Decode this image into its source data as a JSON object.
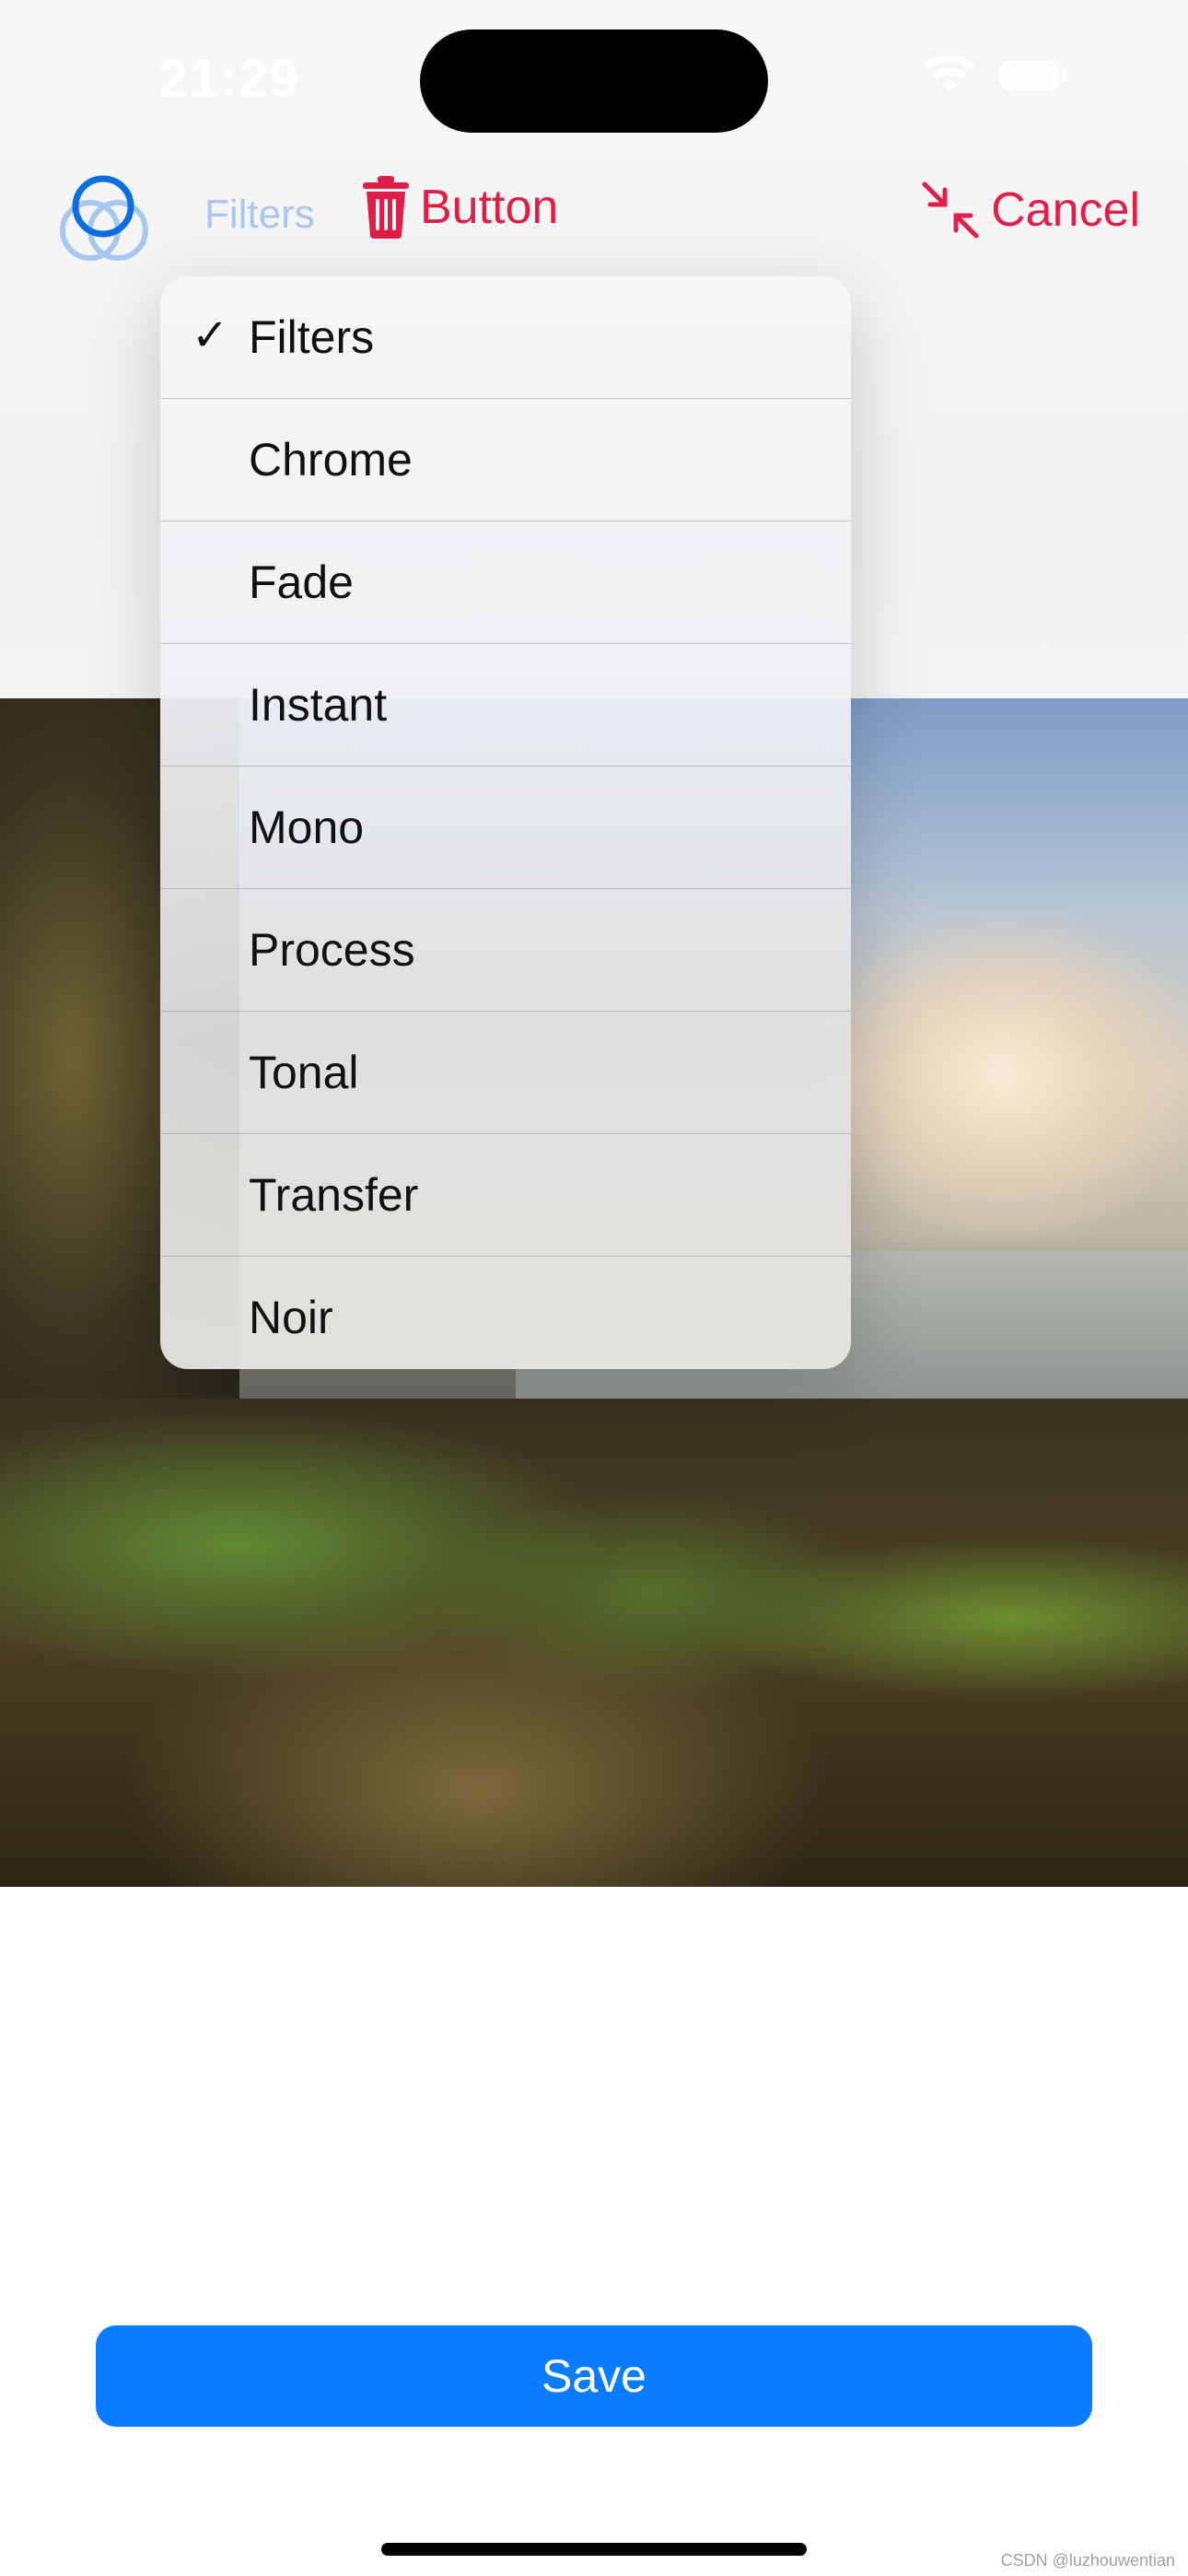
{
  "status_bar": {
    "time": "21:29"
  },
  "toolbar": {
    "filters_label": "Filters",
    "delete_label": "Button",
    "cancel_label": "Cancel",
    "filters_icon": "three-circles-icon",
    "delete_icon": "trash-icon",
    "cancel_icon": "collapse-arrows-icon",
    "accent_color": "#de1f48",
    "filters_color": "#0a6de0"
  },
  "menu": {
    "selected": "Filters",
    "items": [
      {
        "label": "Filters",
        "checked": true
      },
      {
        "label": "Chrome",
        "checked": false
      },
      {
        "label": "Fade",
        "checked": false
      },
      {
        "label": "Instant",
        "checked": false
      },
      {
        "label": "Mono",
        "checked": false
      },
      {
        "label": "Process",
        "checked": false
      },
      {
        "label": "Tonal",
        "checked": false
      },
      {
        "label": "Transfer",
        "checked": false
      },
      {
        "label": "Noir",
        "checked": false
      }
    ],
    "check_glyph": "✓"
  },
  "save": {
    "label": "Save",
    "color": "#0a7cff"
  },
  "watermark": "CSDN @luzhouwentian"
}
